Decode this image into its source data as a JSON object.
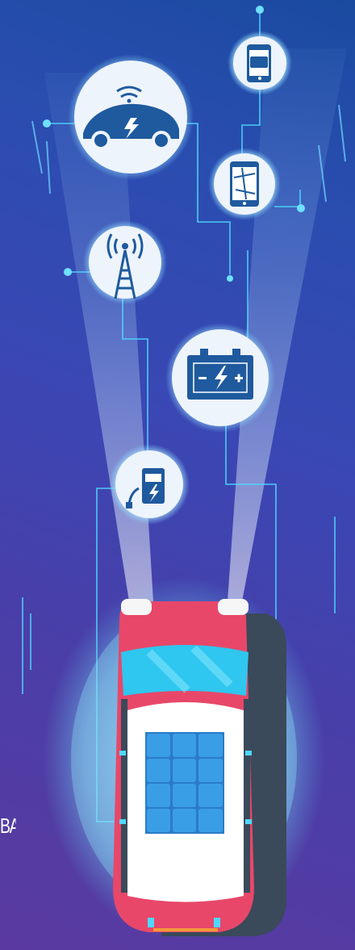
{
  "side_text": "ВА",
  "colors": {
    "background_top": "#1a4aa0",
    "background_bottom": "#5a3aa0",
    "circuit_line": "#4fd8ff",
    "icon_circle": "#eef4fb",
    "icon_blue": "#1f5a9e",
    "car_body": "#e8476a",
    "car_shadow": "#3a4a5a",
    "windshield": "#2fc6ef",
    "roof": "#ffffff",
    "solar_panel": "#3a9ee6"
  },
  "icons": [
    "smartphone-card-payment-icon",
    "connected-electric-car-icon",
    "smartphone-map-icon",
    "radio-tower-icon",
    "car-battery-icon",
    "charging-station-icon"
  ]
}
